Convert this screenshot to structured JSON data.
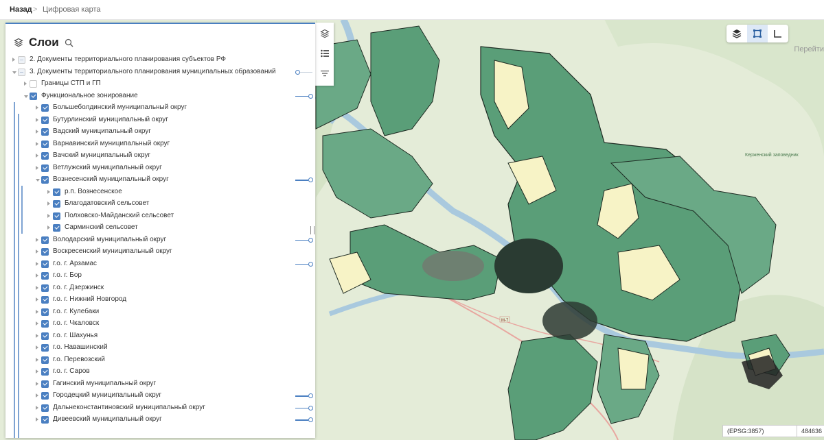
{
  "breadcrumb": {
    "back_label": "Назад",
    "separator": ">",
    "current": "Цифровая карта"
  },
  "panel": {
    "title": "Слои",
    "layers": [
      {
        "label": "2. Документы территориального планирования субъектов РФ",
        "level": 0,
        "expand": "right",
        "check": "indet",
        "slider": "none"
      },
      {
        "label": "3. Документы территориального планирования муниципальных образований",
        "level": 0,
        "expand": "down",
        "check": "indet",
        "slider": "min"
      },
      {
        "label": "Границы СТП и ГП",
        "level": 1,
        "expand": "right",
        "check": "none",
        "slider": "none"
      },
      {
        "label": "Функциональное зонирование",
        "level": 1,
        "expand": "down",
        "check": "checked",
        "slider": "full"
      },
      {
        "label": "Большеболдинский муниципальный округ",
        "level": 2,
        "expand": "right",
        "check": "checked",
        "slider": "none"
      },
      {
        "label": "Бутурлинский муниципальный округ",
        "level": 2,
        "expand": "right",
        "check": "checked",
        "slider": "none"
      },
      {
        "label": "Вадский муниципальный округ",
        "level": 2,
        "expand": "right",
        "check": "checked",
        "slider": "none"
      },
      {
        "label": "Варнавинский муниципальный округ",
        "level": 2,
        "expand": "right",
        "check": "checked",
        "slider": "none"
      },
      {
        "label": "Вачский муниципальный округ",
        "level": 2,
        "expand": "right",
        "check": "checked",
        "slider": "none"
      },
      {
        "label": "Ветлужский муниципальный округ",
        "level": 2,
        "expand": "right",
        "check": "checked",
        "slider": "none"
      },
      {
        "label": "Вознесенский муниципальный округ",
        "level": 2,
        "expand": "down",
        "check": "checked",
        "slider": "full"
      },
      {
        "label": "р.п. Вознесенское",
        "level": 3,
        "expand": "right",
        "check": "checked",
        "slider": "none"
      },
      {
        "label": "Благодатовский сельсовет",
        "level": 3,
        "expand": "right",
        "check": "checked",
        "slider": "none"
      },
      {
        "label": "Полховско-Майданский сельсовет",
        "level": 3,
        "expand": "right",
        "check": "checked",
        "slider": "none"
      },
      {
        "label": "Сарминский сельсовет",
        "level": 3,
        "expand": "right",
        "check": "checked",
        "slider": "none"
      },
      {
        "label": "Володарский муниципальный округ",
        "level": 2,
        "expand": "right",
        "check": "checked",
        "slider": "full"
      },
      {
        "label": "Воскресенский муниципальный округ",
        "level": 2,
        "expand": "right",
        "check": "checked",
        "slider": "none"
      },
      {
        "label": "г.о. г. Арзамас",
        "level": 2,
        "expand": "right",
        "check": "checked",
        "slider": "full"
      },
      {
        "label": "г.о. г. Бор",
        "level": 2,
        "expand": "right",
        "check": "checked",
        "slider": "none"
      },
      {
        "label": "г.о. г. Дзержинск",
        "level": 2,
        "expand": "right",
        "check": "checked",
        "slider": "none"
      },
      {
        "label": "г.о. г. Нижний Новгород",
        "level": 2,
        "expand": "right",
        "check": "checked",
        "slider": "none"
      },
      {
        "label": "г.о. г. Кулебаки",
        "level": 2,
        "expand": "right",
        "check": "checked",
        "slider": "none"
      },
      {
        "label": "г.о. г. Чкаловск",
        "level": 2,
        "expand": "right",
        "check": "checked",
        "slider": "none"
      },
      {
        "label": "г.о. г. Шахунья",
        "level": 2,
        "expand": "right",
        "check": "checked",
        "slider": "none"
      },
      {
        "label": "г.о. Навашинский",
        "level": 2,
        "expand": "right",
        "check": "checked",
        "slider": "none"
      },
      {
        "label": "г.о. Перевозский",
        "level": 2,
        "expand": "right",
        "check": "checked",
        "slider": "none"
      },
      {
        "label": "г.о. г. Саров",
        "level": 2,
        "expand": "right",
        "check": "checked",
        "slider": "none"
      },
      {
        "label": "Гагинский муниципальный округ",
        "level": 2,
        "expand": "right",
        "check": "checked",
        "slider": "none"
      },
      {
        "label": "Городецкий муниципальный округ",
        "level": 2,
        "expand": "right",
        "check": "checked",
        "slider": "full"
      },
      {
        "label": "Дальнеконстантиновский муниципальный округ",
        "level": 2,
        "expand": "right",
        "check": "checked",
        "slider": "full"
      },
      {
        "label": "Дивеевский муниципальный округ",
        "level": 2,
        "expand": "right",
        "check": "checked",
        "slider": "full"
      }
    ]
  },
  "map": {
    "link_text": "Перейти",
    "epsg": "(EPSG:3857)",
    "coord_value": "484636",
    "labels": {
      "forest": "Керженский заповедник",
      "road": "М-7"
    }
  },
  "icons": {
    "layers": "layers-icon",
    "search": "search-icon",
    "list": "list-icon",
    "filter": "filter-icon",
    "rect": "rectangle-select-icon",
    "ruler": "ruler-icon"
  },
  "colors": {
    "accent": "#4a7fc1",
    "zone_green": "#5a9e78",
    "zone_yellow": "#f7f3c6",
    "water": "#a9c9de",
    "forest_bg": "#dbe7cf"
  }
}
